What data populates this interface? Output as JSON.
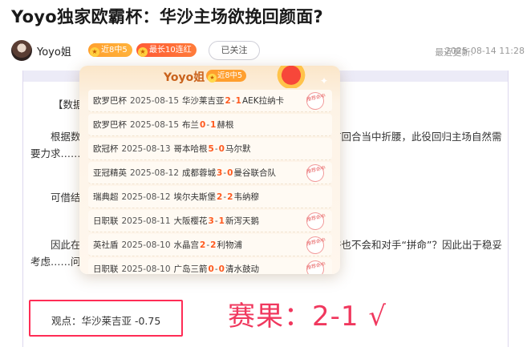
{
  "article": {
    "title": "Yoyo独家欧霸杯：华沙主场欲挽回颜面?",
    "author": {
      "name": "Yoyo姐",
      "badge_streak": "近8中5",
      "badge_longest": "最长10连红",
      "follow_label": "已关注"
    },
    "update_label": "最近更新:",
    "update_time": "2025-08-14 11:28",
    "paragraphs": {
      "label": "【数据",
      "p1": "根据数……坐拥主场之利的华沙莱吉亚给予到不错的信心……在首回合当中折腰，此役回归主场自然需要力求……",
      "p2": "可借结……面对AEK的时候均遭受失利，球队或许在心理层……",
      "p3": "因此在……足对华沙莱吉亚作出不小的支撑力度，确实有……或许也不会和对手“拼命”？因此出于稳妥考虑……问题不大呀！——（附赠比分参考：2-0、3-1、2-1）"
    },
    "viewpoint": "观点：华沙莱吉亚 -0.75",
    "result": "赛果：2-1 √"
  },
  "popup": {
    "name": "Yoyo姐",
    "badge": "近8中5",
    "stamp_text": "推荐命中",
    "records": [
      {
        "league": "欧罗巴杯",
        "date": "2025-08-15",
        "home": "华沙莱吉亚",
        "home_score": "2",
        "away_score": "1",
        "away": "AEK拉纳卡",
        "hit": true
      },
      {
        "league": "欧罗巴杯",
        "date": "2025-08-15",
        "home": "布兰",
        "home_score": "0",
        "away_score": "1",
        "away": "赫根",
        "hit": false
      },
      {
        "league": "欧冠杯",
        "date": "2025-08-13",
        "home": "哥本哈根",
        "home_score": "5",
        "away_score": "0",
        "away": "马尔默",
        "hit": false
      },
      {
        "league": "亚冠精英",
        "date": "2025-08-12",
        "home": "成都蓉城",
        "home_score": "3",
        "away_score": "0",
        "away": "曼谷联合队",
        "hit": true
      },
      {
        "league": "瑞典超",
        "date": "2025-08-12",
        "home": "埃尔夫斯堡",
        "home_score": "2",
        "away_score": "2",
        "away": "韦纳穆",
        "hit": false
      },
      {
        "league": "日职联",
        "date": "2025-08-11",
        "home": "大阪樱花",
        "home_score": "3",
        "away_score": "1",
        "away": "新泻天鹅",
        "hit": true
      },
      {
        "league": "英社盾",
        "date": "2025-08-10",
        "home": "水晶宫",
        "home_score": "2",
        "away_score": "2",
        "away": "利物浦",
        "hit": true
      },
      {
        "league": "日职联",
        "date": "2025-08-10",
        "home": "广岛三箭",
        "home_score": "0",
        "away_score": "0",
        "away": "清水鼓动",
        "hit": true
      }
    ]
  },
  "colors": {
    "accent_orange": "#ff9f2e",
    "score_orange": "#ff5a1f",
    "result_red": "#f0385e",
    "highlight_box": "#ff2c55"
  },
  "icons": {
    "avatar": "user-avatar",
    "medal": "medal-icon",
    "trophy": "trophy-icon",
    "stamp": "hit-stamp-icon"
  }
}
